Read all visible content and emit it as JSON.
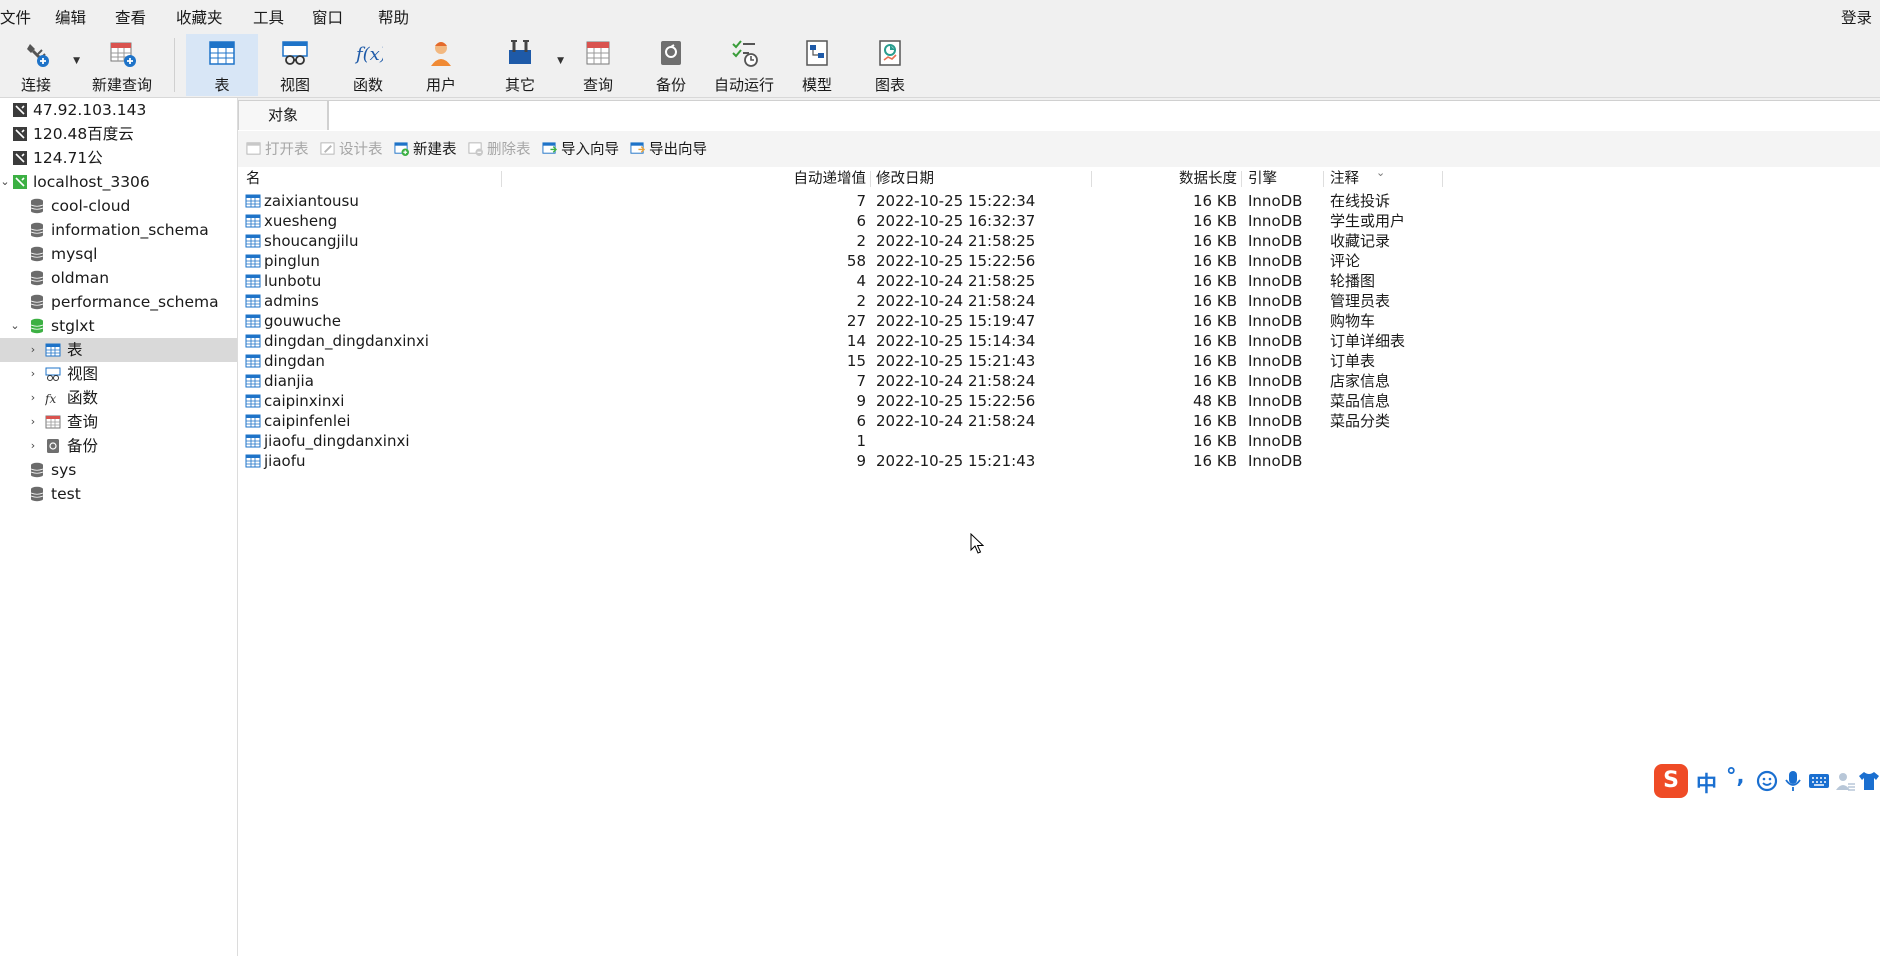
{
  "menubar": {
    "items": [
      "文件",
      "编辑",
      "查看",
      "收藏夹",
      "工具",
      "窗口",
      "帮助"
    ],
    "login": "登录"
  },
  "toolbar": {
    "connect": "连接",
    "new_query": "新建查询",
    "table": "表",
    "view": "视图",
    "function": "函数",
    "user": "用户",
    "other": "其它",
    "query": "查询",
    "backup": "备份",
    "auto_run": "自动运行",
    "model": "模型",
    "chart": "图表"
  },
  "sidebar": {
    "connections": [
      {
        "label": "47.92.103.143"
      },
      {
        "label": "120.48百度云"
      },
      {
        "label": "124.71公"
      },
      {
        "label": "localhost_3306"
      }
    ],
    "databases": [
      "cool-cloud",
      "information_schema",
      "mysql",
      "oldman",
      "performance_schema",
      "stglxt",
      "sys",
      "test"
    ],
    "stglxt_children": [
      "表",
      "视图",
      "函数",
      "查询",
      "备份"
    ]
  },
  "tabs": {
    "object": "对象"
  },
  "object_toolbar": {
    "open_table": "打开表",
    "design_table": "设计表",
    "new_table": "新建表",
    "delete_table": "删除表",
    "import_wizard": "导入向导",
    "export_wizard": "导出向导"
  },
  "grid": {
    "columns": {
      "name": "名",
      "auto_inc": "自动递增值",
      "modified": "修改日期",
      "data_length": "数据长度",
      "engine": "引擎",
      "comment": "注释"
    },
    "rows": [
      {
        "name": "zaixiantousu",
        "auto_inc": "7",
        "modified": "2022-10-25 15:22:34",
        "size": "16 KB",
        "engine": "InnoDB",
        "comment": "在线投诉"
      },
      {
        "name": "xuesheng",
        "auto_inc": "6",
        "modified": "2022-10-25 16:32:37",
        "size": "16 KB",
        "engine": "InnoDB",
        "comment": "学生或用户"
      },
      {
        "name": "shoucangjilu",
        "auto_inc": "2",
        "modified": "2022-10-24 21:58:25",
        "size": "16 KB",
        "engine": "InnoDB",
        "comment": "收藏记录"
      },
      {
        "name": "pinglun",
        "auto_inc": "58",
        "modified": "2022-10-25 15:22:56",
        "size": "16 KB",
        "engine": "InnoDB",
        "comment": "评论"
      },
      {
        "name": "lunbotu",
        "auto_inc": "4",
        "modified": "2022-10-24 21:58:25",
        "size": "16 KB",
        "engine": "InnoDB",
        "comment": "轮播图"
      },
      {
        "name": "admins",
        "auto_inc": "2",
        "modified": "2022-10-24 21:58:24",
        "size": "16 KB",
        "engine": "InnoDB",
        "comment": "管理员表"
      },
      {
        "name": "gouwuche",
        "auto_inc": "27",
        "modified": "2022-10-25 15:19:47",
        "size": "16 KB",
        "engine": "InnoDB",
        "comment": "购物车"
      },
      {
        "name": "dingdan_dingdanxinxi",
        "auto_inc": "14",
        "modified": "2022-10-25 15:14:34",
        "size": "16 KB",
        "engine": "InnoDB",
        "comment": "订单详细表"
      },
      {
        "name": "dingdan",
        "auto_inc": "15",
        "modified": "2022-10-25 15:21:43",
        "size": "16 KB",
        "engine": "InnoDB",
        "comment": "订单表"
      },
      {
        "name": "dianjia",
        "auto_inc": "7",
        "modified": "2022-10-24 21:58:24",
        "size": "16 KB",
        "engine": "InnoDB",
        "comment": "店家信息"
      },
      {
        "name": "caipinxinxi",
        "auto_inc": "9",
        "modified": "2022-10-25 15:22:56",
        "size": "48 KB",
        "engine": "InnoDB",
        "comment": "菜品信息"
      },
      {
        "name": "caipinfenlei",
        "auto_inc": "6",
        "modified": "2022-10-24 21:58:24",
        "size": "16 KB",
        "engine": "InnoDB",
        "comment": "菜品分类"
      },
      {
        "name": "jiaofu_dingdanxinxi",
        "auto_inc": "1",
        "modified": "",
        "size": "16 KB",
        "engine": "InnoDB",
        "comment": ""
      },
      {
        "name": "jiaofu",
        "auto_inc": "9",
        "modified": "2022-10-25 15:21:43",
        "size": "16 KB",
        "engine": "InnoDB",
        "comment": ""
      }
    ]
  },
  "ime": {
    "logo": "S",
    "mode": "中",
    "punct": "°,"
  },
  "colors": {
    "accent": "#1e73c8",
    "active_tool_bg": "#d8e6f6",
    "selected_row": "#d9d9d9",
    "connection_green": "#3cb043",
    "ime_brand": "#ef4b26"
  }
}
